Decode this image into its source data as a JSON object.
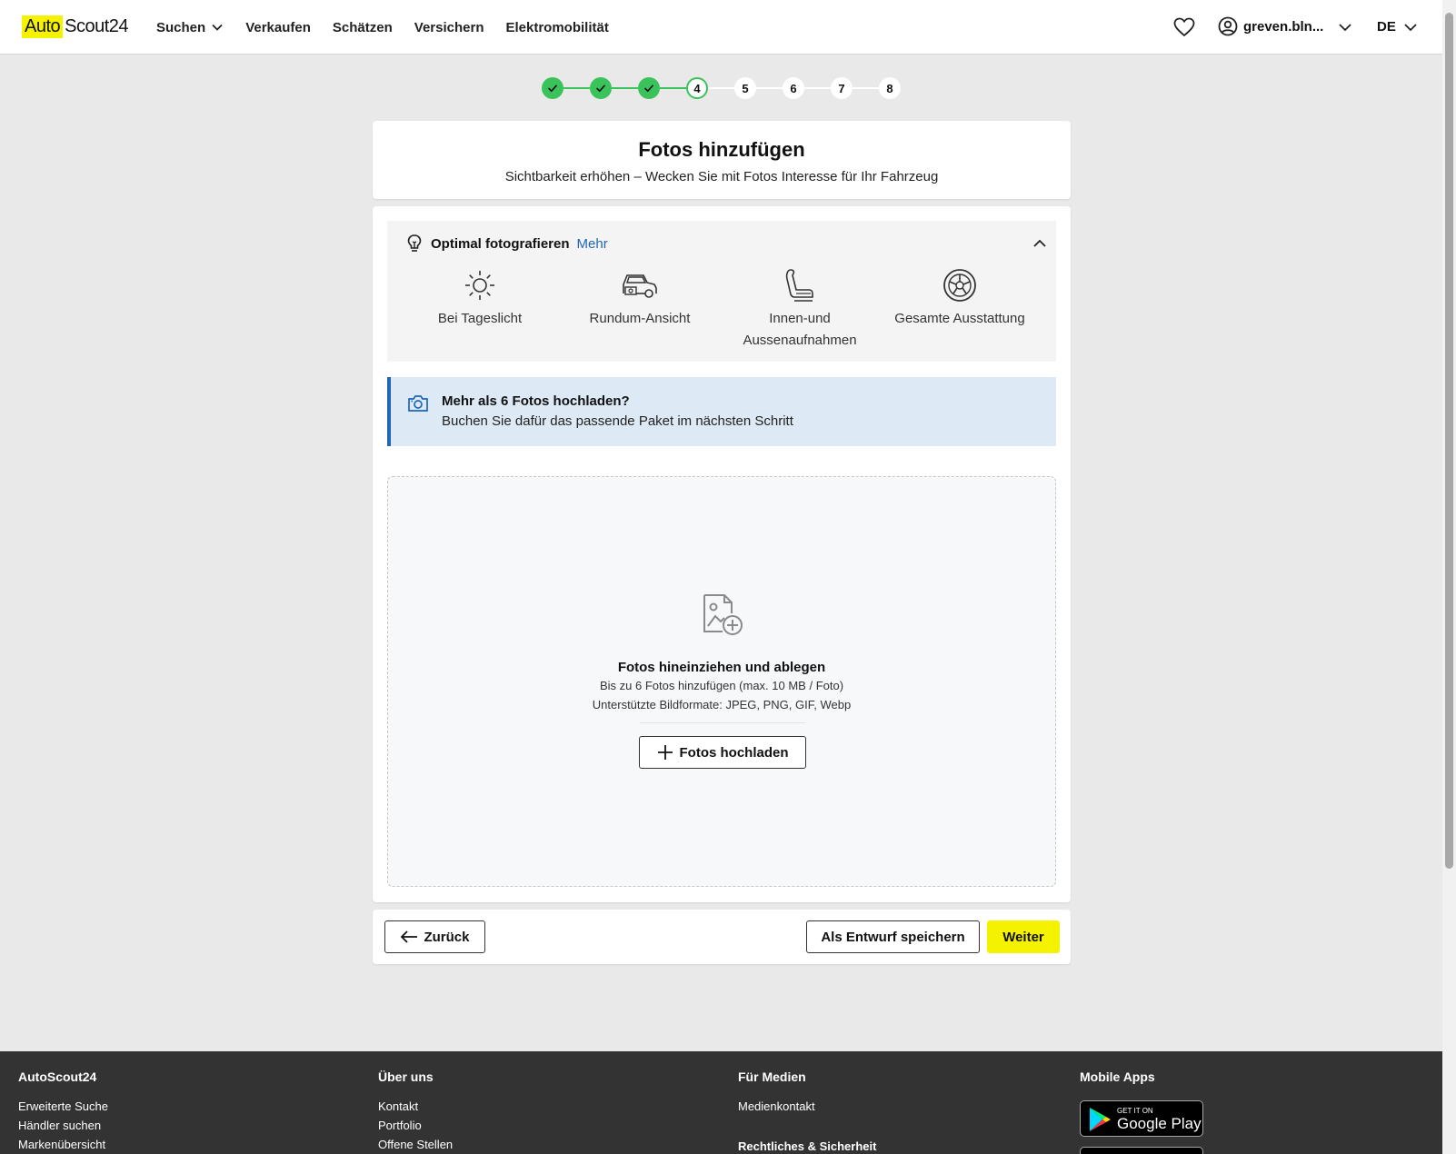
{
  "header": {
    "logo_auto": "Auto",
    "logo_scout": "Scout24",
    "nav": [
      "Suchen",
      "Verkaufen",
      "Schätzen",
      "Versichern",
      "Elektromobilität"
    ],
    "user_name": "greven.bln...",
    "language": "DE"
  },
  "stepper": {
    "steps": [
      "1",
      "2",
      "3",
      "4",
      "5",
      "6",
      "7",
      "8"
    ],
    "completed_steps": 3,
    "current_step": 4
  },
  "title_card": {
    "title": "Fotos hinzufügen",
    "subtitle": "Sichtbarkeit erhöhen – Wecken Sie mit Fotos Interesse für Ihr Fahrzeug"
  },
  "tips": {
    "heading": "Optimal fotografieren",
    "more_link": "Mehr",
    "items": [
      {
        "icon": "sun-icon",
        "label": "Bei Tageslicht"
      },
      {
        "icon": "car-view-icon",
        "label": "Rundum-Ansicht"
      },
      {
        "icon": "car-seat-icon",
        "label": "Innen-und Aussenaufnahmen"
      },
      {
        "icon": "steering-wheel-icon",
        "label": "Gesamte Ausstattung"
      }
    ]
  },
  "info_box": {
    "title": "Mehr als 6 Fotos hochladen?",
    "text": "Buchen Sie dafür das passende Paket im nächsten Schritt"
  },
  "dropzone": {
    "title": "Fotos hineinziehen und ablegen",
    "limit": "Bis zu 6 Fotos hinzufügen (max. 10 MB / Foto)",
    "formats": "Unterstützte Bildformate: JPEG, PNG, GIF, Webp",
    "upload_button": "Fotos hochladen"
  },
  "actions": {
    "back": "Zurück",
    "draft": "Als Entwurf speichern",
    "next": "Weiter"
  },
  "footer": {
    "col1": {
      "heading": "AutoScout24",
      "links": [
        "Erweiterte Suche",
        "Händler suchen",
        "Markenübersicht"
      ]
    },
    "col2": {
      "heading": "Über uns",
      "links": [
        "Kontakt",
        "Portfolio",
        "Offene Stellen"
      ]
    },
    "col3": {
      "heading": "Für Medien",
      "links": [
        "Medienkontakt"
      ],
      "subheading": "Rechtliches & Sicherheit"
    },
    "col4": {
      "heading": "Mobile Apps",
      "google_play_small": "GET IT ON",
      "google_play_big": "Google Play"
    }
  },
  "colors": {
    "brand_yellow": "#f5f200",
    "step_green": "#3bc35b",
    "info_blue": "#1f66b8",
    "footer_bg": "#333333"
  }
}
